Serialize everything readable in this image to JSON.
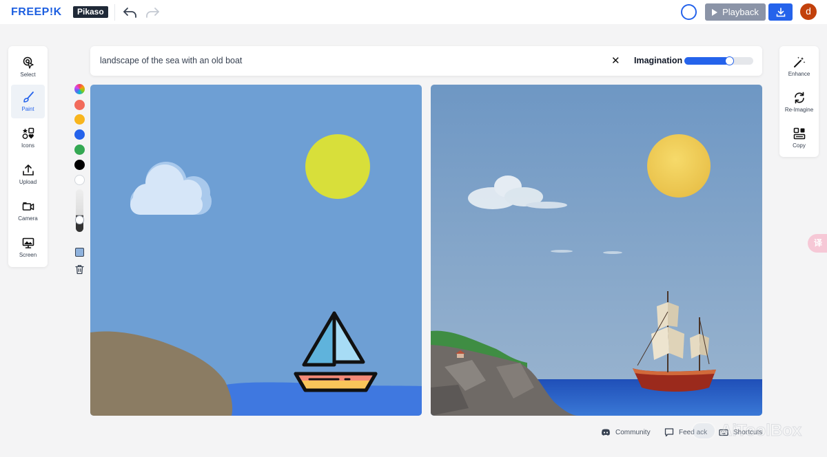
{
  "header": {
    "logo_text": "FREEP!K",
    "logo_badge": "Pikaso",
    "playback_label": "Playback",
    "avatar_initial": "d"
  },
  "tools_left": [
    {
      "label": "Select",
      "icon": "select-cursor-icon"
    },
    {
      "label": "Paint",
      "icon": "paint-brush-icon",
      "active": true
    },
    {
      "label": "Icons",
      "icon": "shapes-icon"
    },
    {
      "label": "Upload",
      "icon": "upload-icon"
    },
    {
      "label": "Camera",
      "icon": "camera-icon"
    },
    {
      "label": "Screen",
      "icon": "screen-icon"
    }
  ],
  "palette": {
    "colors": [
      "#f26b5b",
      "#f8b51d",
      "#2563eb",
      "#34a853",
      "#000000",
      "#ffffff"
    ],
    "fill_color": "#8fb2dd"
  },
  "prompt": {
    "text": "landscape of the sea with an old boat",
    "imagination_label": "Imagination",
    "imagination_level": 0.65
  },
  "tools_right": [
    {
      "label": "Enhance",
      "icon": "magic-wand-icon"
    },
    {
      "label": "Re-Imagine",
      "icon": "refresh-icon"
    },
    {
      "label": "Copy",
      "icon": "copy-icon"
    }
  ],
  "translate_glyph": "译",
  "footer": {
    "community": "Community",
    "feedback": "Feed  ack",
    "shortcuts": "Shortcuts"
  },
  "watermark": "AiToolBox",
  "colors": {
    "accent": "#2563eb",
    "canvas_sky": "#6e9fd4",
    "sun": "#d8df3a",
    "sea": "#3f78e0"
  }
}
